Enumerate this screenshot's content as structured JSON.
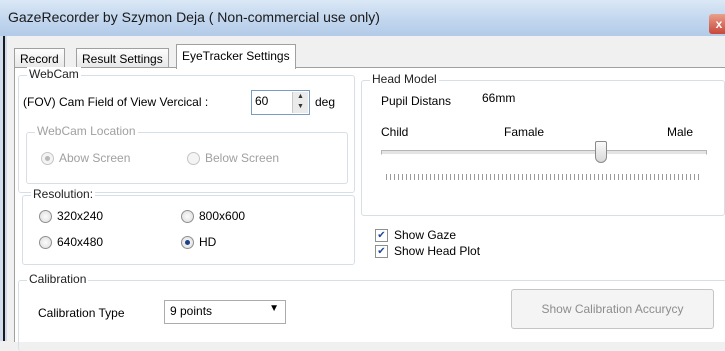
{
  "window": {
    "title": "GazeRecorder   by Szymon Deja  ( Non-commercial use only)",
    "close_glyph": "x"
  },
  "tabs": [
    {
      "label": "Record"
    },
    {
      "label": "Result Settings"
    },
    {
      "label": "EyeTracker Settings",
      "active": true
    }
  ],
  "webcam": {
    "legend": "WebCam",
    "fov_label": "(FOV) Cam Field of View Vercical  :",
    "fov_value": "60",
    "fov_unit": "deg",
    "location": {
      "legend": "WebCam Location",
      "options": [
        {
          "label": "Abow Screen",
          "selected": true
        },
        {
          "label": "Below Screen",
          "selected": false
        }
      ]
    }
  },
  "resolution": {
    "legend": "Resolution:",
    "options": [
      {
        "label": "320x240",
        "selected": false
      },
      {
        "label": "800x600",
        "selected": false
      },
      {
        "label": "640x480",
        "selected": false
      },
      {
        "label": "HD",
        "selected": true
      }
    ]
  },
  "head_model": {
    "legend": "Head Model",
    "pupil_label": "Pupil Distans",
    "pupil_value": "66mm",
    "slider_labels": {
      "left": "Child",
      "middle": "Famale",
      "right": "Male"
    },
    "slider_position": 0.68
  },
  "options": {
    "show_gaze": {
      "label": "Show Gaze",
      "checked": true
    },
    "show_head_plot": {
      "label": "Show Head Plot",
      "checked": true
    }
  },
  "calibration": {
    "legend": "Calibration",
    "type_label": "Calibration Type",
    "type_value": "9 points",
    "accuracy_button": "Show Calibration Accurycy"
  },
  "colors": {
    "title_bar": "#c2d6ee",
    "radio_dot": "#1c3f8a",
    "checkmark": "#1c4a9c",
    "close_button": "#c9463a"
  }
}
